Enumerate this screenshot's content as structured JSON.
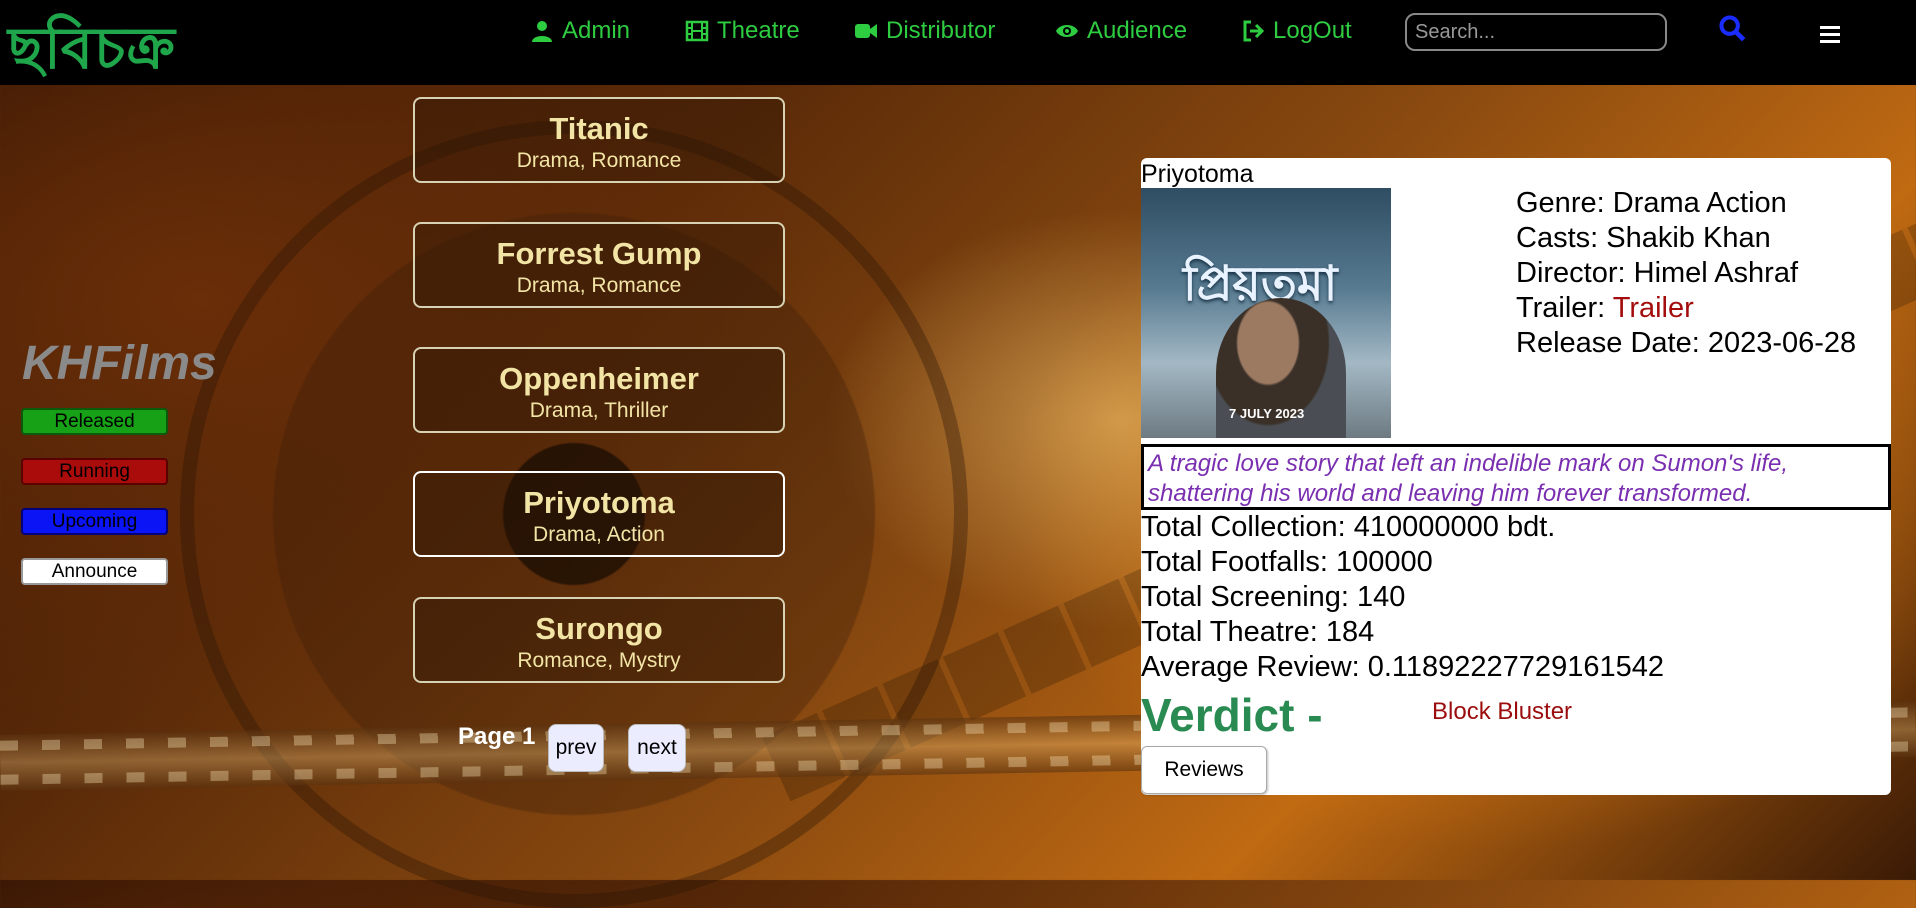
{
  "brand": {
    "logo_text": "ছবিচক্র"
  },
  "nav": {
    "items": [
      {
        "label": "Admin",
        "icon": "user-icon"
      },
      {
        "label": "Theatre",
        "icon": "film-icon"
      },
      {
        "label": "Distributor",
        "icon": "video-camera-icon"
      },
      {
        "label": "Audience",
        "icon": "eye-icon"
      },
      {
        "label": "LogOut",
        "icon": "logout-icon"
      }
    ],
    "search_placeholder": "Search...",
    "accent_color": "#2ecc40"
  },
  "sidebar": {
    "company": "KHFilms",
    "status_filters": [
      "Released",
      "Running",
      "Upcoming",
      "Announce"
    ],
    "status_colors": [
      "#17a117",
      "#aa0c0c",
      "#0a14f5",
      "#ffffff"
    ]
  },
  "movies": [
    {
      "title": "Titanic",
      "genre": "Drama, Romance"
    },
    {
      "title": "Forrest Gump",
      "genre": "Drama, Romance"
    },
    {
      "title": "Oppenheimer",
      "genre": "Drama, Thriller"
    },
    {
      "title": "Priyotoma",
      "genre": "Drama, Action"
    },
    {
      "title": "Surongo",
      "genre": "Romance, Mystry"
    }
  ],
  "pagination": {
    "page_label": "Page 1",
    "prev": "prev",
    "next": "next"
  },
  "detail": {
    "title": "Priyotoma",
    "poster": {
      "title_text": "প্রিয়তমা",
      "date_text": "7 JULY 2023"
    },
    "genre": "Genre: Drama Action",
    "casts": "Casts: Shakib Khan",
    "director": "Director: Himel Ashraf",
    "trailer_label": "Trailer: ",
    "trailer_link": "Trailer",
    "release_date": "Release Date: 2023-06-28",
    "tagline": "A tragic love story that left an indelible mark on Sumon's life, shattering his world and leaving him forever transformed.",
    "total_collection": "Total Collection: 410000000 bdt.",
    "total_footfalls": "Total Footfalls: 100000",
    "total_screening": "Total Screening: 140",
    "total_theatre": "Total Theatre: 184",
    "average_review": "Average Review: 0.11892227729161542",
    "verdict_label": "Verdict -",
    "verdict_value": "Block Bluster",
    "reviews_button": "Reviews"
  }
}
